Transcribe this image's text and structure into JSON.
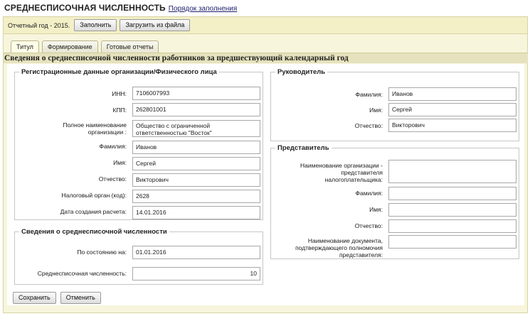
{
  "header": {
    "title": "СРЕДНЕСПИСОЧНАЯ ЧИСЛЕННОСТЬ",
    "help_link": "Порядок заполнения"
  },
  "toolbar": {
    "year_text": "Отчетный год - 2015.",
    "fill_label": "Заполнить",
    "load_label": "Загрузить из файла"
  },
  "tabs": [
    {
      "label": "Титул"
    },
    {
      "label": "Формирование"
    },
    {
      "label": "Готовые отчеты"
    }
  ],
  "section_title": "Сведения о среднесписочной численности работников за предшествующий календарный год",
  "registration": {
    "legend": "Регистрационные данные организации/Физического лица",
    "inn": {
      "label": "ИНН:",
      "value": "7106007993"
    },
    "kpp": {
      "label": "КПП:",
      "value": "262801001"
    },
    "org_name": {
      "label": "Полное наименование организации :",
      "value": "Общество с ограниченной ответственностью \"Восток\""
    },
    "last_name": {
      "label": "Фамилия:",
      "value": "Иванов"
    },
    "first_name": {
      "label": "Имя:",
      "value": "Сергей"
    },
    "patronymic": {
      "label": "Отчество:",
      "value": "Викторович"
    },
    "tax_office": {
      "label": "Налоговый орган (код):",
      "value": "2628"
    },
    "creation_date": {
      "label": "Дата создания расчета:",
      "value": "14.01.2016"
    }
  },
  "headcount": {
    "legend": "Сведения о среднесписочной численности",
    "as_of": {
      "label": "По состоянию на:",
      "value": "01.01.2016"
    },
    "average": {
      "label": "Среднесписочная численность:",
      "value": "10"
    }
  },
  "director": {
    "legend": "Руководитель",
    "last_name": {
      "label": "Фамилия:",
      "value": "Иванов"
    },
    "first_name": {
      "label": "Имя:",
      "value": "Сергей"
    },
    "patronymic": {
      "label": "Отчество:",
      "value": "Викторович"
    }
  },
  "representative": {
    "legend": "Представитель",
    "org_name": {
      "label": "Наименование организации - представителя налогоплательщика:",
      "value": ""
    },
    "last_name": {
      "label": "Фамилия:",
      "value": ""
    },
    "first_name": {
      "label": "Имя:",
      "value": ""
    },
    "patronymic": {
      "label": "Отчество:",
      "value": ""
    },
    "document": {
      "label": "Наименование документа, подтверждающего полномочия представителя:",
      "value": ""
    }
  },
  "actions": {
    "save_label": "Сохранить",
    "cancel_label": "Отменить"
  }
}
